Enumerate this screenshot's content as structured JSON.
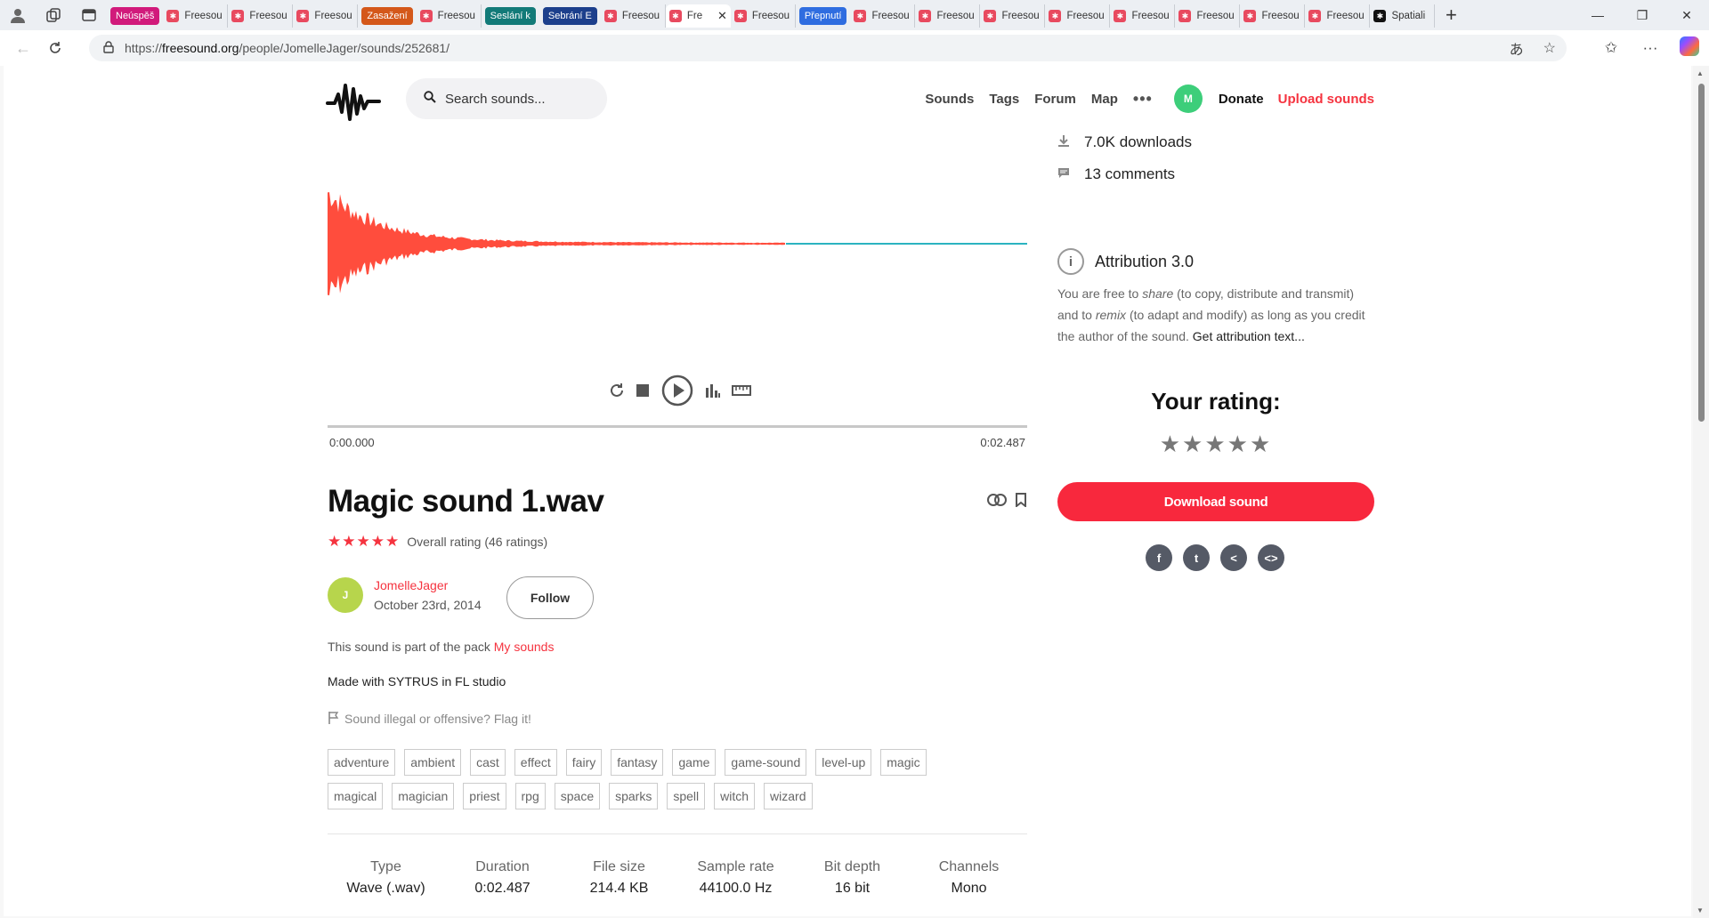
{
  "browser": {
    "tabs": [
      {
        "label": "Neúspěš",
        "group_color": "#d11a7b",
        "kind": "group"
      },
      {
        "label": "Freesou",
        "kind": "tab"
      },
      {
        "label": "Freesou",
        "kind": "tab"
      },
      {
        "label": "Freesou",
        "kind": "tab"
      },
      {
        "label": "Zasažení",
        "group_color": "#d4581a",
        "kind": "group"
      },
      {
        "label": "Freesou",
        "kind": "tab"
      },
      {
        "label": "Seslání k",
        "group_color": "#127a78",
        "kind": "group"
      },
      {
        "label": "Sebrání E",
        "group_color": "#1c3f8c",
        "kind": "group"
      },
      {
        "label": "Freesou",
        "kind": "tab"
      },
      {
        "label": "Fre",
        "kind": "active"
      },
      {
        "label": "Freesou",
        "kind": "tab"
      },
      {
        "label": "Přepnutí",
        "group_color": "#2f6de0",
        "kind": "group"
      },
      {
        "label": "Freesou",
        "kind": "tab"
      },
      {
        "label": "Freesou",
        "kind": "tab"
      },
      {
        "label": "Freesou",
        "kind": "tab"
      },
      {
        "label": "Freesou",
        "kind": "tab"
      },
      {
        "label": "Freesou",
        "kind": "tab"
      },
      {
        "label": "Freesou",
        "kind": "tab"
      },
      {
        "label": "Freesou",
        "kind": "tab"
      },
      {
        "label": "Freesou",
        "kind": "tab"
      },
      {
        "label": "Spatiali",
        "kind": "tab"
      }
    ],
    "url_prefix": "https://",
    "url_host": "freesound.org",
    "url_path": "/people/JomelleJager/sounds/252681/"
  },
  "header": {
    "search_placeholder": "Search sounds...",
    "nav": [
      "Sounds",
      "Tags",
      "Forum",
      "Map"
    ],
    "more": "•••",
    "avatar_initial": "M",
    "donate": "Donate",
    "upload": "Upload sounds"
  },
  "player": {
    "time_start": "0:00.000",
    "time_end": "0:02.487",
    "wave_color": "#ff4d3d",
    "line_color": "#2bb3c0"
  },
  "sound": {
    "title": "Magic sound 1.wav",
    "rating_stars": "★★★★★",
    "rating_text": "Overall rating (46 ratings)",
    "author_initial": "J",
    "author": "JomelleJager",
    "date": "October 23rd, 2014",
    "follow": "Follow",
    "pack_prefix": "This sound is part of the pack ",
    "pack_name": "My sounds",
    "description": "Made with SYTRUS in FL studio",
    "flag": "Sound illegal or offensive? Flag it!",
    "tags": [
      "adventure",
      "ambient",
      "cast",
      "effect",
      "fairy",
      "fantasy",
      "game",
      "game-sound",
      "level-up",
      "magic",
      "magical",
      "magician",
      "priest",
      "rpg",
      "space",
      "sparks",
      "spell",
      "witch",
      "wizard"
    ],
    "specs": [
      {
        "k": "Type",
        "v": "Wave (.wav)"
      },
      {
        "k": "Duration",
        "v": "0:02.487"
      },
      {
        "k": "File size",
        "v": "214.4 KB"
      },
      {
        "k": "Sample rate",
        "v": "44100.0 Hz"
      },
      {
        "k": "Bit depth",
        "v": "16 bit"
      },
      {
        "k": "Channels",
        "v": "Mono"
      }
    ]
  },
  "sidebar": {
    "downloads": "7.0K downloads",
    "comments": "13 comments",
    "license_title": "Attribution 3.0",
    "license_t1": "You are free to ",
    "license_share": "share",
    "license_t2": " (to copy, distribute and transmit) and to ",
    "license_remix": "remix",
    "license_t3": " (to adapt and modify) as long as you credit the author of the sound. ",
    "license_link": "Get attribution text...",
    "your_rating": "Your rating:",
    "rate_stars": "★★★★★",
    "download": "Download sound",
    "share": [
      {
        "name": "facebook-icon",
        "glyph": "f"
      },
      {
        "name": "twitter-icon",
        "glyph": "t"
      },
      {
        "name": "share-icon",
        "glyph": "<"
      },
      {
        "name": "embed-icon",
        "glyph": "<>"
      }
    ]
  }
}
